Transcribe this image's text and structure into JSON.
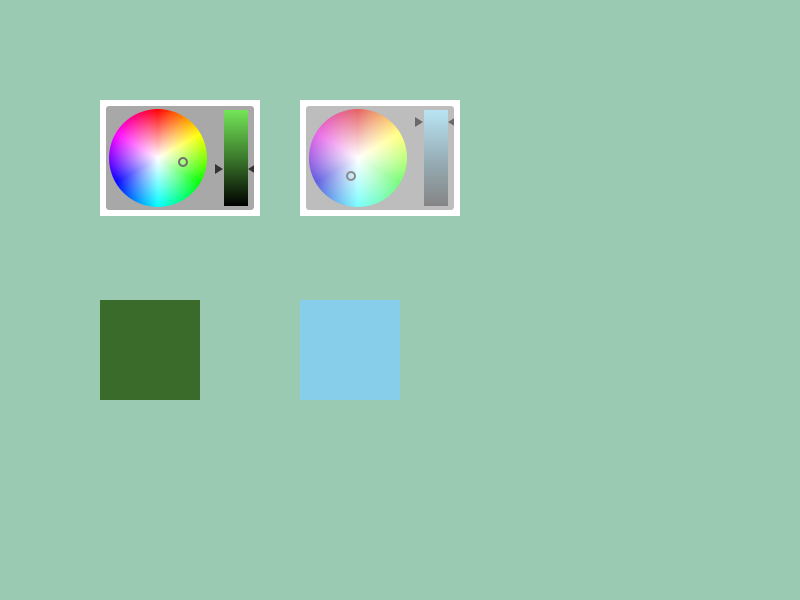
{
  "background": "#9bcab2",
  "pickers": [
    {
      "selected_color": "#3b6b2a",
      "value_level": 0.5,
      "panel_color": "#a8a8a8"
    },
    {
      "selected_color": "#87ceeb",
      "value_level": 0.9,
      "panel_color": "#bdbdbd"
    }
  ],
  "icons": {
    "wheel_marker": "circle-ring-icon",
    "slider_arrow_left": "triangle-right-icon",
    "slider_arrow_right": "triangle-left-icon"
  }
}
